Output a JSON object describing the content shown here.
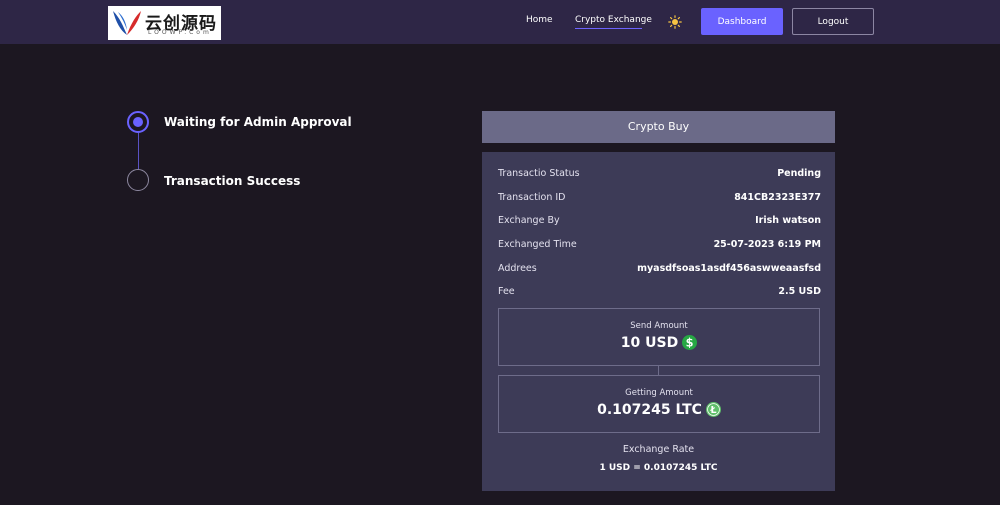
{
  "header": {
    "logo_text": "云创源码",
    "logo_subtext": "LOOWP.Com",
    "nav": {
      "home": "Home",
      "crypto_exchange": "Crypto Exchange"
    },
    "theme_icon": "sun-icon",
    "dashboard_label": "Dashboard",
    "logout_label": "Logout"
  },
  "steps": [
    {
      "label": "Waiting for Admin Approval",
      "state": "active"
    },
    {
      "label": "Transaction Success",
      "state": "pending"
    }
  ],
  "card": {
    "title": "Crypto Buy",
    "rows": [
      {
        "key": "Transactio Status",
        "value": "Pending"
      },
      {
        "key": "Transaction ID",
        "value": "841CB2323E377"
      },
      {
        "key": "Exchange By",
        "value": "Irish watson"
      },
      {
        "key": "Exchanged Time",
        "value": "25-07-2023 6:19 PM"
      },
      {
        "key": "Addrees",
        "value": "myasdfsoas1asdf456aswweaasfsd"
      },
      {
        "key": "Fee",
        "value": "2.5 USD"
      }
    ],
    "send": {
      "label": "Send Amount",
      "value": "10 USD",
      "icon": "usd-coin-icon"
    },
    "get": {
      "label": "Getting Amount",
      "value": "0.107245 LTC",
      "icon": "ltc-coin-icon"
    },
    "exchange_rate_label": "Exchange Rate",
    "exchange_rate_value": "1 USD = 0.0107245 LTC"
  },
  "colors": {
    "header_bg": "#2e2646",
    "page_bg": "#1c1721",
    "accent": "#6a62ff",
    "card_header_bg": "#6b6a88",
    "card_body_bg": "#3d3b57",
    "usd_green": "#27a844",
    "ltc_green": "#5fbf6a"
  }
}
